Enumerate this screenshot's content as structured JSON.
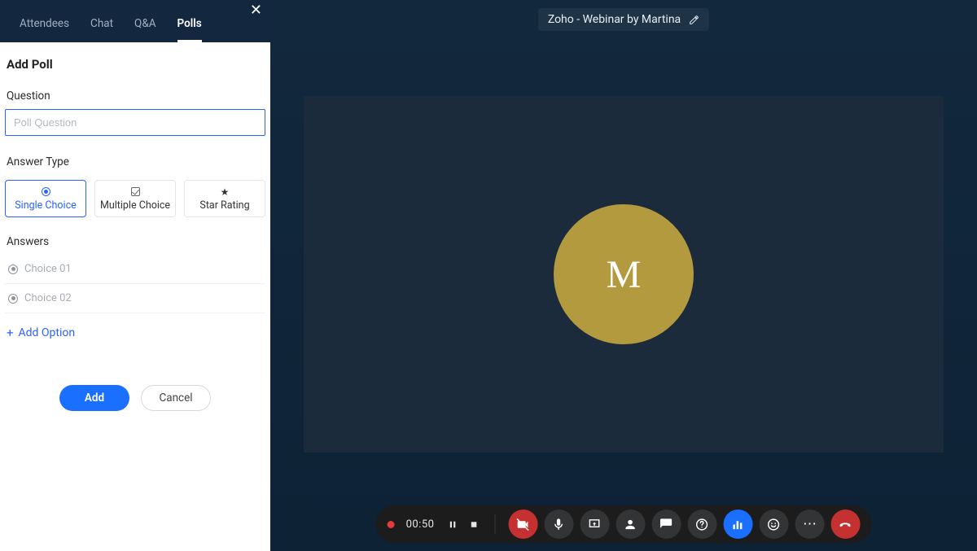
{
  "sidebar": {
    "tabs": [
      "Attendees",
      "Chat",
      "Q&A",
      "Polls"
    ],
    "active_tab_index": 3,
    "panel_title": "Add Poll",
    "question_label": "Question",
    "question_placeholder": "Poll Question",
    "question_value": "",
    "answer_type_label": "Answer Type",
    "answer_types": [
      {
        "label": "Single Choice",
        "selected": true
      },
      {
        "label": "Multiple Choice",
        "selected": false
      },
      {
        "label": "Star Rating",
        "selected": false
      }
    ],
    "answers_label": "Answers",
    "answers": [
      "Choice 01",
      "Choice 02"
    ],
    "add_option_label": "Add Option",
    "add_button": "Add",
    "cancel_button": "Cancel"
  },
  "header": {
    "webinar_title": "Zoho - Webinar by Martina"
  },
  "participant": {
    "avatar_letter": "M",
    "avatar_color": "#b49a3f"
  },
  "controls": {
    "timer": "00:50"
  }
}
